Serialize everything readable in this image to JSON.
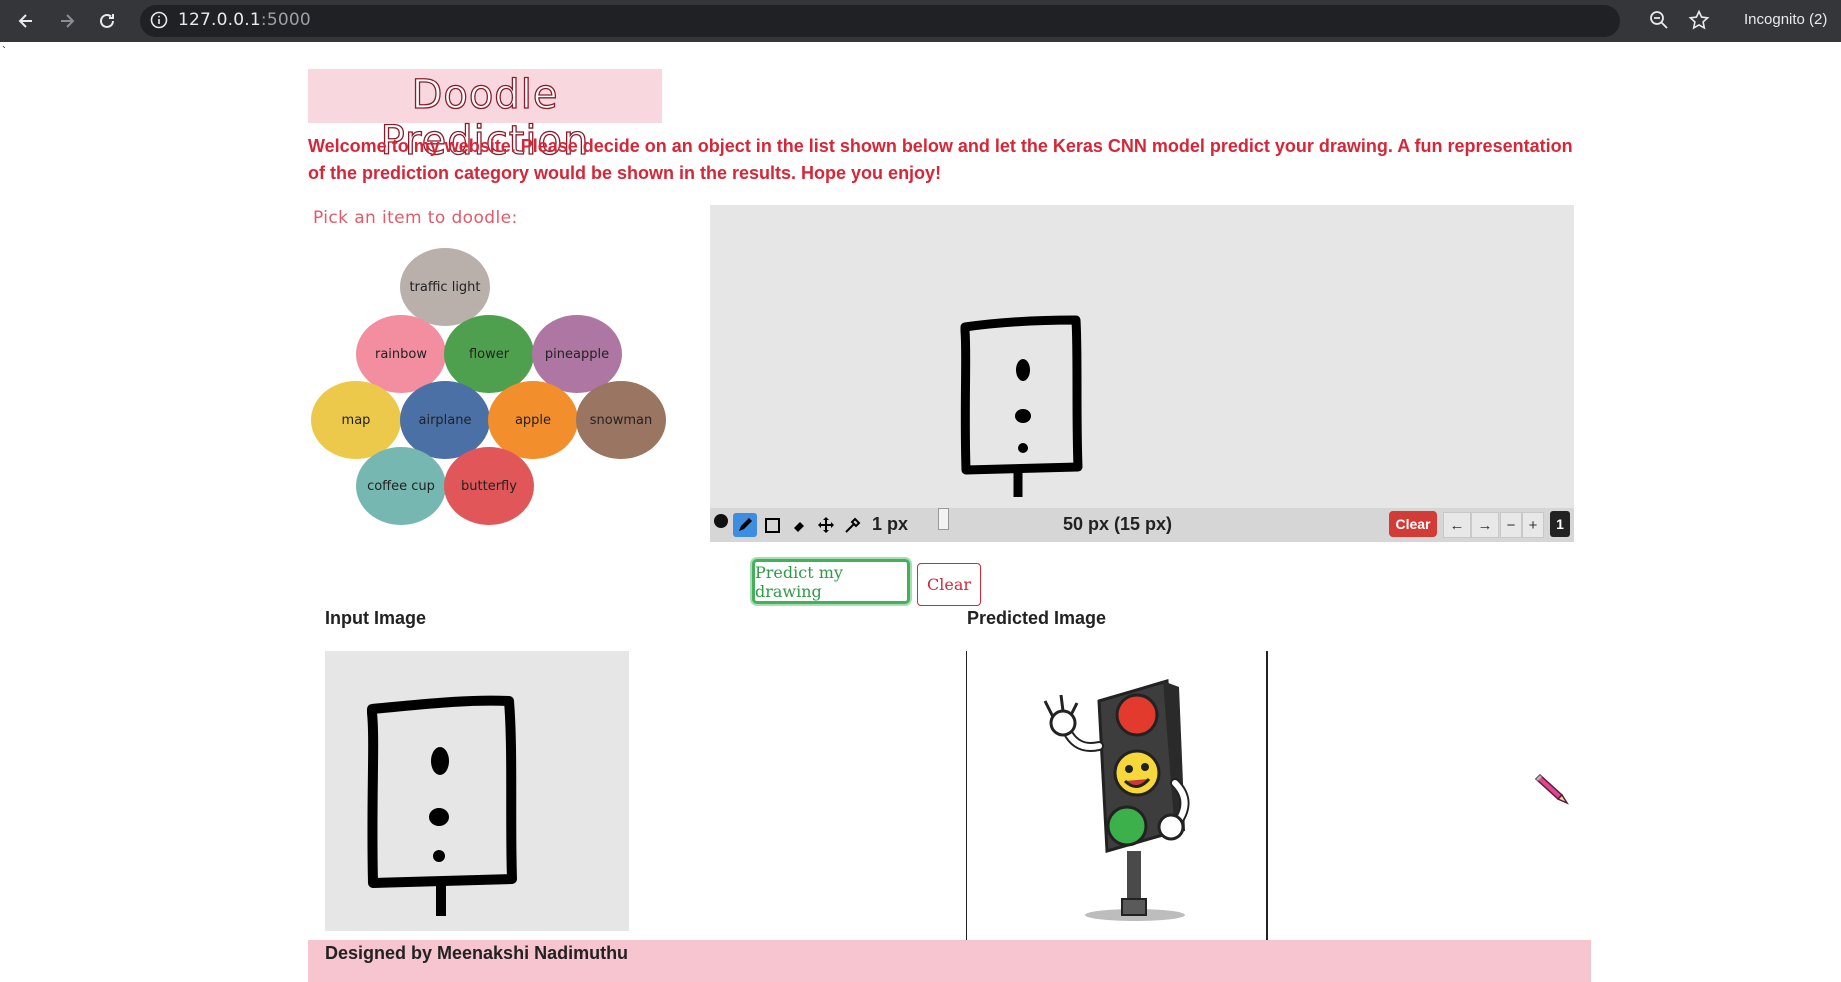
{
  "browser": {
    "url_host": "127.0.0.1",
    "url_port": ":5000",
    "profile_label": "Incognito (2)"
  },
  "stray_char": "`",
  "page": {
    "title": "Doodle Prediction",
    "welcome": "Welcome to my website. Please decide on an object in the list shown below and let the Keras CNN model predict your drawing. A fun representation of the prediction category would be shown in the results. Hope you enjoy!",
    "pick_label": "Pick an item to doodle:"
  },
  "items": [
    {
      "label": "traffic light",
      "color": "#b9afab"
    },
    {
      "label": "rainbow",
      "color": "#f28ea0"
    },
    {
      "label": "flower",
      "color": "#4fa04e"
    },
    {
      "label": "pineapple",
      "color": "#ae77a3"
    },
    {
      "label": "map",
      "color": "#ecc94a"
    },
    {
      "label": "airplane",
      "color": "#4a70a5"
    },
    {
      "label": "apple",
      "color": "#f28e2b"
    },
    {
      "label": "snowman",
      "color": "#9a7561"
    },
    {
      "label": "coffee cup",
      "color": "#76b7b2"
    },
    {
      "label": "butterfly",
      "color": "#e15759"
    }
  ],
  "toolbar": {
    "brush_size_label": "1 px",
    "size_readout": "50 px (15 px)",
    "clear_label": "Clear",
    "undo_label": "←",
    "redo_label": "→",
    "zoom_out_label": "−",
    "zoom_in_label": "+",
    "page_number": "1"
  },
  "actions": {
    "predict_label": "Predict my drawing",
    "clear_label": "Clear"
  },
  "results": {
    "input_label": "Input Image",
    "predicted_label": "Predicted Image"
  },
  "footer": {
    "credit": "Designed by Meenakshi Nadimuthu"
  },
  "colors": {
    "accent_red": "#d72638",
    "predict_green": "#44b05a",
    "footer_pink": "#f6c5cf",
    "title_bg": "#f8d7df"
  }
}
